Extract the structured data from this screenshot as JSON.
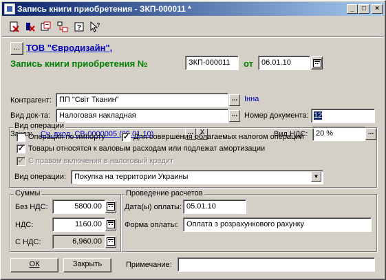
{
  "window": {
    "title": "Запись книги приобретения - ЗКП-000011 *",
    "controls": [
      "_",
      "□",
      "×"
    ]
  },
  "toolbar": {
    "icons": [
      "delete-doc-icon",
      "delete-x-icon",
      "copy-doc-icon",
      "structure-icon",
      "help-icon",
      "context-help-icon"
    ]
  },
  "header": {
    "dots_button": "...",
    "company": "ТОВ \"Євродизайн\",",
    "heading": "Запись книги приобретения №",
    "number": "ЗКП-000011",
    "from_label": "от",
    "date": "06.01.10"
  },
  "form": {
    "counterparty_label": "Контрагент:",
    "counterparty": "ПП \"Світ Тканин\"",
    "counterparty_note": "Інна",
    "doc_type_label": "Вид док-та:",
    "doc_type": "Налоговая накладная",
    "doc_number_label": "Номер документа:",
    "doc_number": "12",
    "order_label": "Заказ:",
    "order": "Сч. вход. СВ-0000005 (05.01.10)",
    "vat_type_label": "Вид НДС:",
    "vat_type": "20 %"
  },
  "operation": {
    "legend": "Вид операции",
    "import_label": "Операция по импорту",
    "import_checked": false,
    "taxable_label": "Для совершения облагаемых налогом операций",
    "taxable_checked": true,
    "gross_label": "Товары относятся к валовым расходам или подлежат амортизации",
    "gross_checked": true,
    "credit_label": "С правом включения в налоговый кредит",
    "credit_checked": true,
    "op_type_label": "Вид операции:",
    "op_type": "Покупка на территории Украины"
  },
  "sums": {
    "legend": "Суммы",
    "no_vat_label": "Без НДС:",
    "no_vat": "5800.00",
    "vat_label": "НДС:",
    "vat": "1160.00",
    "with_vat_label": "С НДС:",
    "with_vat": "6,960.00"
  },
  "payment": {
    "legend": "Проведение расчетов",
    "dates_label": "Дата(ы) оплаты:",
    "dates": "05.01.10",
    "form_label": "Форма оплаты:",
    "form": "Оплата з розрахункового рахунку"
  },
  "footer": {
    "ok": "ОК",
    "close": "Закрыть",
    "note_label": "Примечание:",
    "note": ""
  }
}
